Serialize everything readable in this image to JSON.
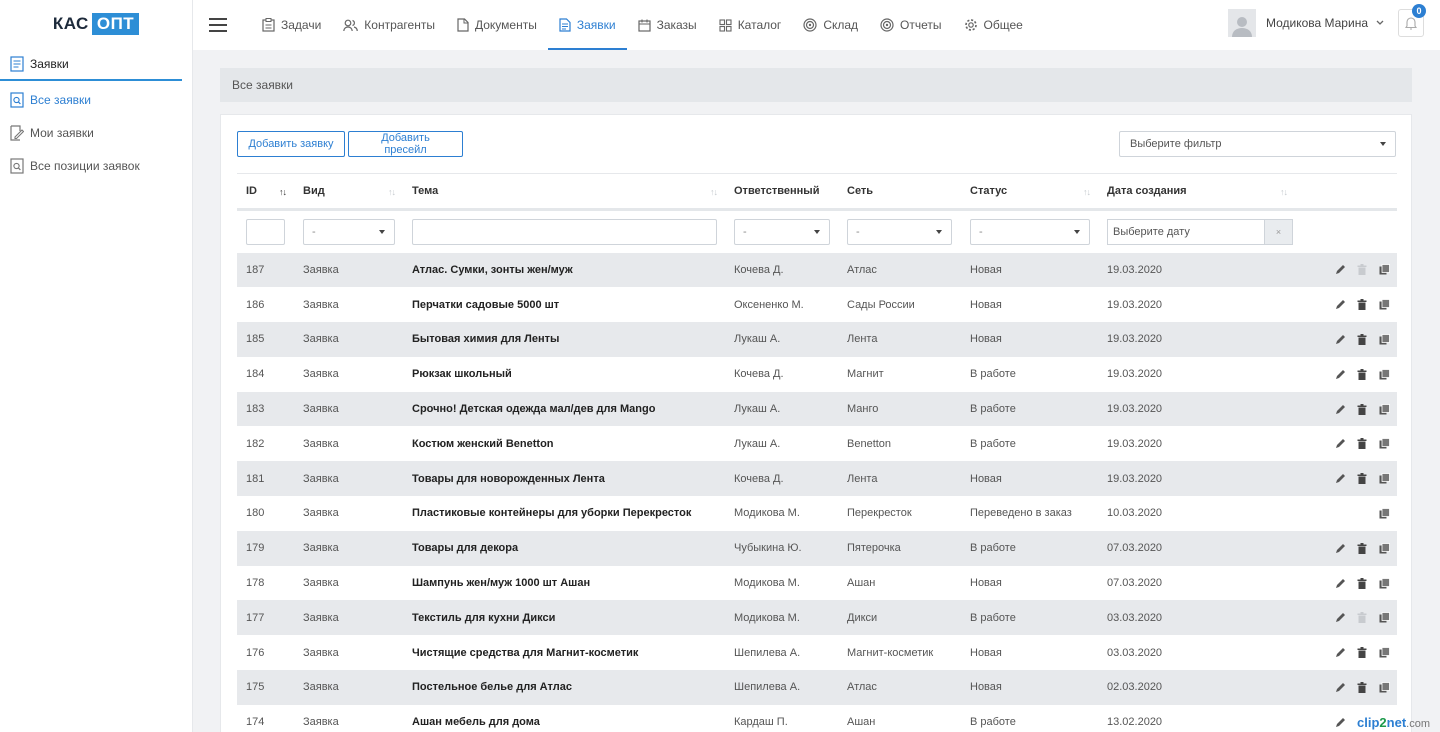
{
  "logo": {
    "part1": "КАС",
    "part2": "ОПТ"
  },
  "sidebar": {
    "items": [
      {
        "label": "Заявки",
        "icon": "document-icon"
      },
      {
        "label": "Все заявки",
        "icon": "search-document-icon"
      },
      {
        "label": "Мои заявки",
        "icon": "edit-document-icon"
      },
      {
        "label": "Все позиции заявок",
        "icon": "search-document-icon"
      }
    ]
  },
  "topnav": {
    "items": [
      {
        "label": "Задачи",
        "icon": "clipboard-icon"
      },
      {
        "label": "Контрагенты",
        "icon": "users-icon"
      },
      {
        "label": "Документы",
        "icon": "file-icon"
      },
      {
        "label": "Заявки",
        "icon": "document-icon"
      },
      {
        "label": "Заказы",
        "icon": "calendar-icon"
      },
      {
        "label": "Каталог",
        "icon": "grid-icon"
      },
      {
        "label": "Склад",
        "icon": "target-icon"
      },
      {
        "label": "Отчеты",
        "icon": "target-icon"
      },
      {
        "label": "Общее",
        "icon": "gear-icon"
      }
    ],
    "user_name": "Модикова Марина",
    "notifications": "0"
  },
  "breadcrumb": "Все заявки",
  "toolbar": {
    "add_request": "Добавить заявку",
    "add_presale": "Добавить пресейл",
    "filter_placeholder": "Выберите фильтр"
  },
  "table": {
    "columns": [
      "ID",
      "Вид",
      "Тема",
      "Ответственный",
      "Сеть",
      "Статус",
      "Дата создания"
    ],
    "filters": {
      "select_default": "-",
      "date_placeholder": "Выберите дату",
      "clear": "×"
    },
    "rows": [
      {
        "id": "187",
        "type": "Заявка",
        "topic": "Атлас. Сумки, зонты жен/муж",
        "owner": "Кочева Д.",
        "network": "Атлас",
        "status": "Новая",
        "date": "19.03.2020",
        "actions": "edit,delete-disabled,copy"
      },
      {
        "id": "186",
        "type": "Заявка",
        "topic": "Перчатки садовые 5000 шт",
        "owner": "Оксененко М.",
        "network": "Сады России",
        "status": "Новая",
        "date": "19.03.2020",
        "actions": "edit,delete,copy"
      },
      {
        "id": "185",
        "type": "Заявка",
        "topic": "Бытовая химия для Ленты",
        "owner": "Лукаш А.",
        "network": "Лента",
        "status": "Новая",
        "date": "19.03.2020",
        "actions": "edit,delete,copy"
      },
      {
        "id": "184",
        "type": "Заявка",
        "topic": "Рюкзак школьный",
        "owner": "Кочева Д.",
        "network": "Магнит",
        "status": "В работе",
        "date": "19.03.2020",
        "actions": "edit,delete,copy"
      },
      {
        "id": "183",
        "type": "Заявка",
        "topic": "Срочно! Детская одежда мал/дев для Mango",
        "owner": "Лукаш А.",
        "network": "Манго",
        "status": "В работе",
        "date": "19.03.2020",
        "actions": "edit,delete,copy"
      },
      {
        "id": "182",
        "type": "Заявка",
        "topic": "Костюм женский Benetton",
        "owner": "Лукаш А.",
        "network": "Benetton",
        "status": "В работе",
        "date": "19.03.2020",
        "actions": "edit,delete,copy"
      },
      {
        "id": "181",
        "type": "Заявка",
        "topic": "Товары для новорожденных Лента",
        "owner": "Кочева Д.",
        "network": "Лента",
        "status": "Новая",
        "date": "19.03.2020",
        "actions": "edit,delete,copy"
      },
      {
        "id": "180",
        "type": "Заявка",
        "topic": "Пластиковые контейнеры для уборки Перекресток",
        "owner": "Модикова М.",
        "network": "Перекресток",
        "status": "Переведено в заказ",
        "date": "10.03.2020",
        "actions": "copy"
      },
      {
        "id": "179",
        "type": "Заявка",
        "topic": "Товары для декора",
        "owner": "Чубыкина Ю.",
        "network": "Пятерочка",
        "status": "В работе",
        "date": "07.03.2020",
        "actions": "edit,delete,copy"
      },
      {
        "id": "178",
        "type": "Заявка",
        "topic": "Шампунь жен/муж 1000 шт Ашан",
        "owner": "Модикова М.",
        "network": "Ашан",
        "status": "Новая",
        "date": "07.03.2020",
        "actions": "edit,delete,copy"
      },
      {
        "id": "177",
        "type": "Заявка",
        "topic": "Текстиль для кухни Дикси",
        "owner": "Модикова М.",
        "network": "Дикси",
        "status": "В работе",
        "date": "03.03.2020",
        "actions": "edit,delete-disabled,copy"
      },
      {
        "id": "176",
        "type": "Заявка",
        "topic": "Чистящие средства для Магнит-косметик",
        "owner": "Шепилева А.",
        "network": "Магнит-косметик",
        "status": "Новая",
        "date": "03.03.2020",
        "actions": "edit,delete,copy"
      },
      {
        "id": "175",
        "type": "Заявка",
        "topic": "Постельное белье для Атлас",
        "owner": "Шепилева А.",
        "network": "Атлас",
        "status": "Новая",
        "date": "02.03.2020",
        "actions": "edit,delete,copy"
      },
      {
        "id": "174",
        "type": "Заявка",
        "topic": "Ашан мебель для дома",
        "owner": "Кардаш П.",
        "network": "Ашан",
        "status": "В работе",
        "date": "13.02.2020",
        "actions": "edit"
      }
    ]
  },
  "watermark": {
    "a": "clip",
    "b": "2",
    "c": "net",
    "d": ".com"
  }
}
